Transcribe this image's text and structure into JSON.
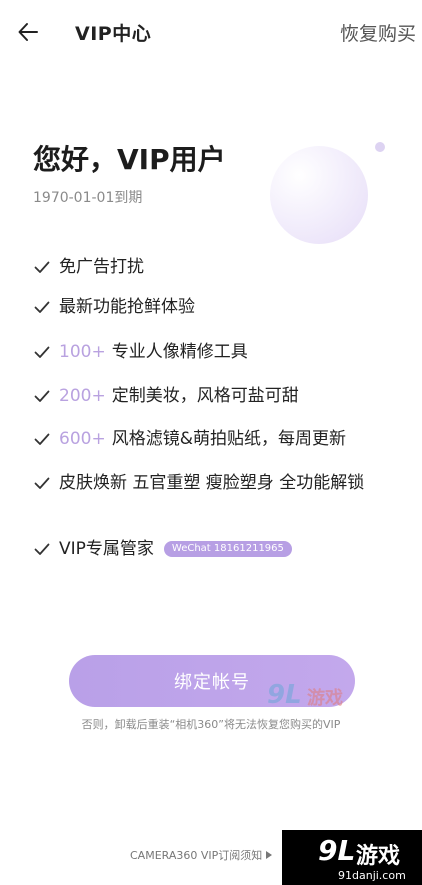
{
  "header": {
    "title": "VIP中心",
    "restore_label": "恢复购买"
  },
  "profile": {
    "greeting": "您好，VIP用户",
    "expire": "1970-01-01到期"
  },
  "features": [
    {
      "accent": "",
      "text": "免广告打扰"
    },
    {
      "accent": "",
      "text": "最新功能抢鲜体验"
    },
    {
      "accent": "100+",
      "text": "专业人像精修工具"
    },
    {
      "accent": "200+",
      "text": "定制美妆，风格可盐可甜"
    },
    {
      "accent": "600+",
      "text": "风格滤镜&萌拍贴纸，每周更新"
    },
    {
      "accent": "",
      "text": "皮肤焕新 五官重塑 瘦脸塑身 全功能解锁"
    },
    {
      "accent": "",
      "text": "VIP专属管家",
      "badge": "WeChat 18161211965"
    }
  ],
  "bind": {
    "label": "绑定帐号",
    "warning": "否则，卸载后重装“相机360”将无法恢复您购买的VIP"
  },
  "footer": {
    "notice": "CAMERA360 VIP订阅须知"
  },
  "watermark": {
    "logo_num": "9L",
    "logo_text": "游戏",
    "url": "91danji.com"
  },
  "colors": {
    "accent": "#b9a2e0",
    "button": "#c0a6ea"
  },
  "icons": {
    "back": "arrow-left-icon",
    "check": "check-icon",
    "play": "triangle-right-icon"
  }
}
